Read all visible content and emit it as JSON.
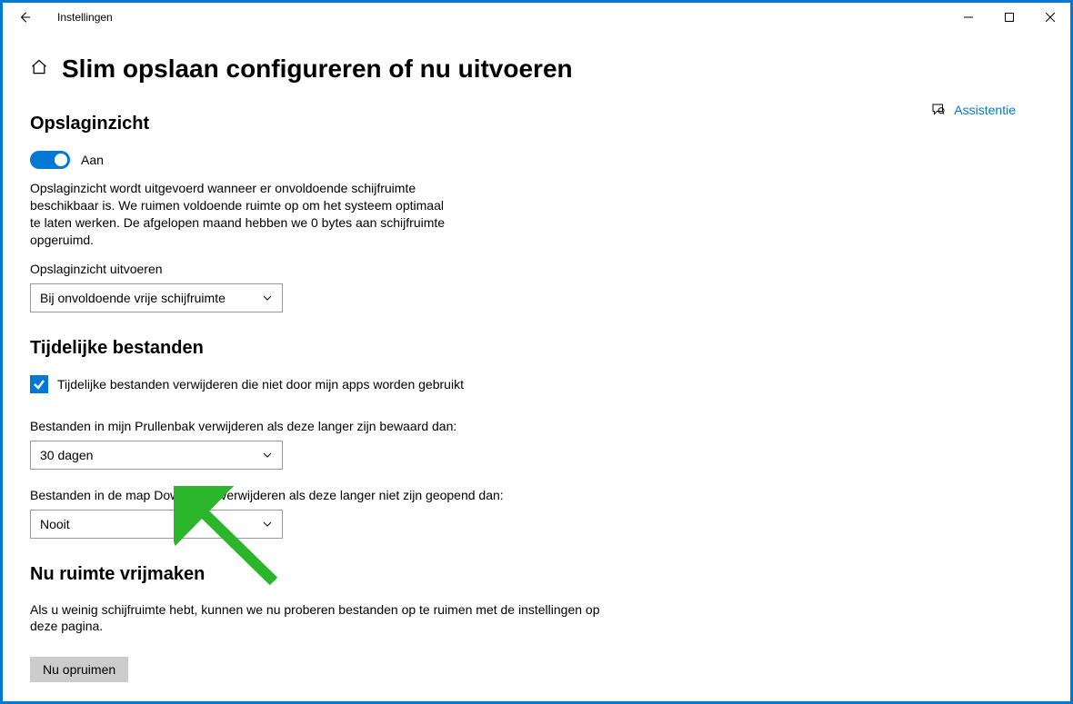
{
  "window": {
    "app_title": "Instellingen"
  },
  "page_title": "Slim opslaan configureren of nu uitvoeren",
  "assistance_link": "Assistentie",
  "section1": {
    "title": "Opslaginzicht",
    "toggle_label": "Aan",
    "description": "Opslaginzicht wordt uitgevoerd wanneer er onvoldoende schijfruimte beschikbaar is. We ruimen voldoende ruimte op om het systeem optimaal te laten werken. De afgelopen maand hebben we 0 bytes aan schijfruimte opgeruimd.",
    "run_label": "Opslaginzicht uitvoeren",
    "run_value": "Bij onvoldoende vrije schijfruimte"
  },
  "section2": {
    "title": "Tijdelijke bestanden",
    "checkbox_label": "Tijdelijke bestanden verwijderen die niet door mijn apps worden gebruikt",
    "recycle_label": "Bestanden in mijn Prullenbak verwijderen als deze langer zijn bewaard dan:",
    "recycle_value": "30 dagen",
    "downloads_label": "Bestanden in de map Downloads verwijderen als deze langer niet zijn geopend dan:",
    "downloads_value": "Nooit"
  },
  "section3": {
    "title": "Nu ruimte vrijmaken",
    "description": "Als u weinig schijfruimte hebt, kunnen we nu proberen bestanden op te ruimen met de instellingen op deze pagina.",
    "button_label": "Nu opruimen"
  }
}
